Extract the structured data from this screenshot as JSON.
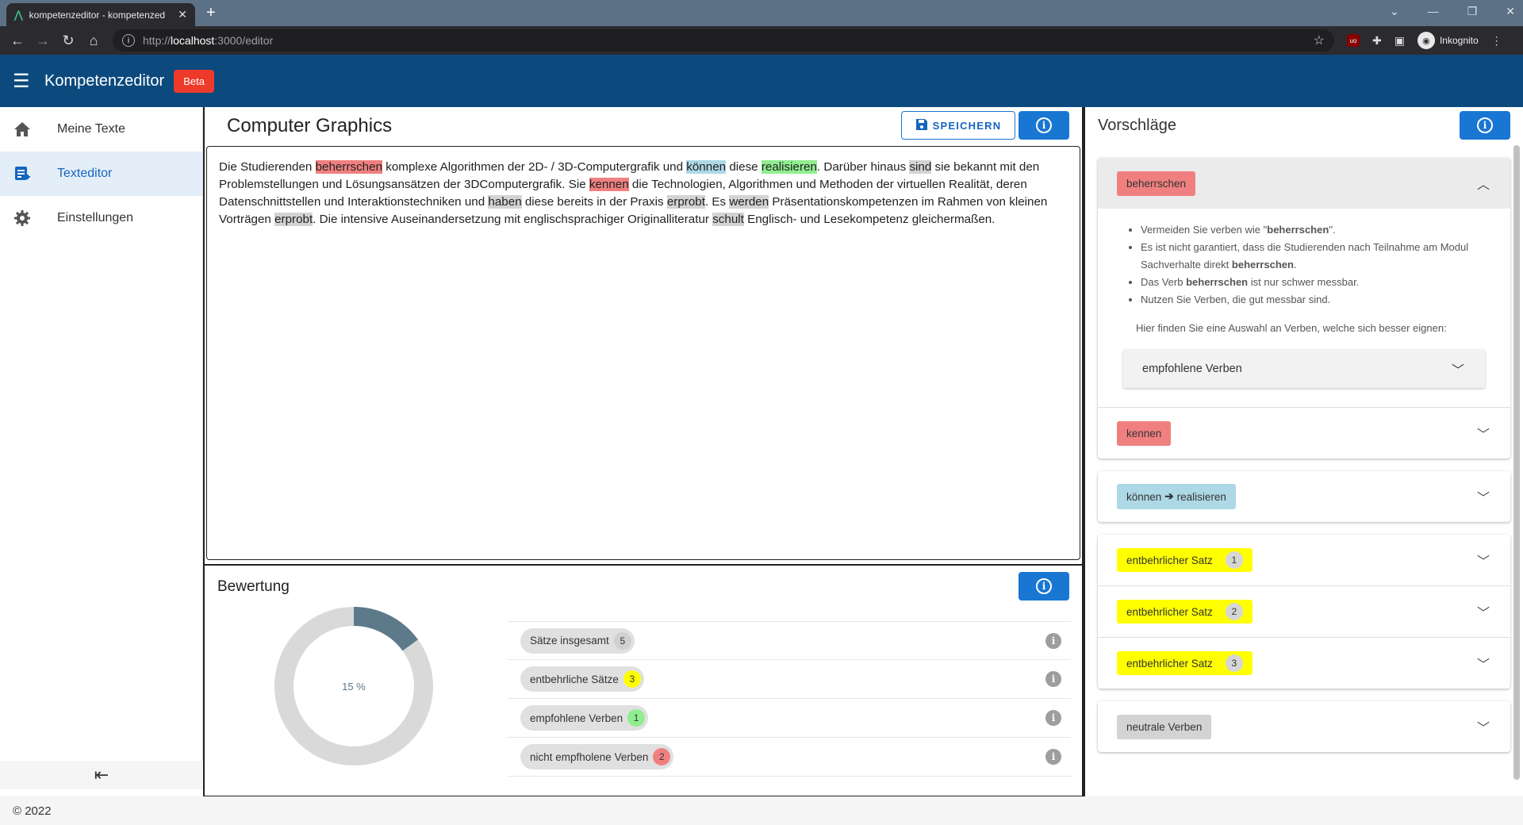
{
  "browser": {
    "tab_title": "kompetenzeditor - kompetenzed",
    "url_prefix": "http://",
    "url_host": "localhost",
    "url_path": ":3000/editor",
    "profile": "Inkognito"
  },
  "appbar": {
    "title": "Kompetenzeditor",
    "badge": "Beta"
  },
  "sidebar": {
    "items": [
      {
        "label": "Meine Texte"
      },
      {
        "label": "Texteditor"
      },
      {
        "label": "Einstellungen"
      }
    ]
  },
  "editor": {
    "title": "Computer Graphics",
    "save_label": "SPEICHERN",
    "text": {
      "p1": "Die Studierenden ",
      "w1": "beherrschen",
      "p2": " komplexe Algorithmen der 2D- / 3D-Computergrafik und ",
      "w2": "können",
      "p3": " diese ",
      "w3": "realisieren",
      "p4": ". Darüber hinaus ",
      "w4": "sind",
      "p5": " sie bekannt mit den Problemstellungen und Lösungsansätzen der 3DComputergrafik. Sie ",
      "w5": "kennen",
      "p6": " die Technologien, Algorithmen und Methoden der virtuellen Realität, deren Datenschnittstellen und Interaktionstechniken und ",
      "w6": "haben",
      "p7": " diese bereits in der Praxis ",
      "w7": "erprobt",
      "p8": ". Es ",
      "w8": "werden",
      "p9": " Präsentationskompetenzen im Rahmen von kleinen Vorträgen ",
      "w9": "erprobt",
      "p10": ". Die intensive Auseinandersetzung mit englischsprachiger Originalliteratur ",
      "w10": "schult",
      "p11": " Englisch- und Lesekompetenz gleichermaßen."
    }
  },
  "evaluation": {
    "title": "Bewertung",
    "score_label": "15 %",
    "score_value": 0.15,
    "stats": [
      {
        "label": "Sätze insgesamt",
        "count": "5",
        "color": "#d0d0d0"
      },
      {
        "label": "entbehrliche Sätze",
        "count": "3",
        "color": "#ffff00"
      },
      {
        "label": "empfohlene Verben",
        "count": "1",
        "color": "#90ee90"
      },
      {
        "label": "nicht empfholene Verben",
        "count": "2",
        "color": "#f08080"
      }
    ]
  },
  "suggestions": {
    "title": "Vorschläge",
    "beherrschen": {
      "tag": "beherrschen",
      "b1_pre": "Vermeiden Sie verben wie \"",
      "b1_word": "beherrschen",
      "b1_post": "\".",
      "b2_pre": "Es ist nicht garantiert, dass die Studierenden nach Teilnahme am Modul Sachverhalte direkt ",
      "b2_word": "beherrschen",
      "b2_post": ".",
      "b3_pre": "Das Verb ",
      "b3_word": "beherrschen",
      "b3_post": " ist nur schwer messbar.",
      "b4": "Nutzen Sie Verben, die gut messbar sind.",
      "hint": "Hier finden Sie eine Auswahl an Verben, welche sich besser eignen:",
      "select_label": "empfohlene Verben"
    },
    "kennen": "kennen",
    "koennen_from": "können",
    "koennen_to": "realisieren",
    "sentences": [
      {
        "label": "entbehrlicher Satz",
        "num": "1"
      },
      {
        "label": "entbehrlicher Satz",
        "num": "2"
      },
      {
        "label": "entbehrlicher Satz",
        "num": "3"
      }
    ],
    "neutral": "neutrale Verben"
  },
  "footer": {
    "copyright": "© 2022"
  },
  "colors": {
    "primary": "#1976d2",
    "appbar": "#0c4a7e",
    "danger": "#ee3a2b",
    "donut_fill": "#5c7a8a",
    "donut_track": "#d9d9d9"
  }
}
